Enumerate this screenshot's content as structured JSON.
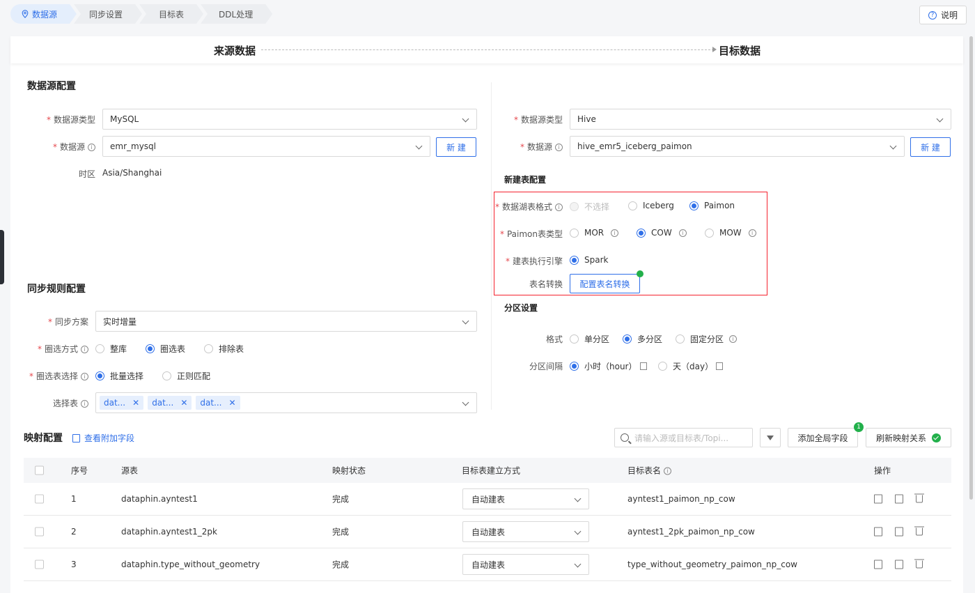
{
  "steps": [
    "数据源",
    "同步设置",
    "目标表",
    "DDL处理"
  ],
  "help_label": "说明",
  "header": {
    "left": "来源数据",
    "right": "目标数据"
  },
  "source": {
    "section_title": "数据源配置",
    "type_label": "数据源类型",
    "type_value": "MySQL",
    "ds_label": "数据源",
    "ds_value": "emr_mysql",
    "new_btn": "新 建",
    "tz_label": "时区",
    "tz_value": "Asia/Shanghai"
  },
  "target": {
    "type_label": "数据源类型",
    "type_value": "Hive",
    "ds_label": "数据源",
    "ds_value": "hive_emr5_iceberg_paimon",
    "new_btn": "新 建",
    "newtable_title": "新建表配置",
    "lake_label": "数据湖表格式",
    "lake_options": [
      "不选择",
      "Iceberg",
      "Paimon"
    ],
    "paimon_label": "Paimon表类型",
    "paimon_options": [
      "MOR",
      "COW",
      "MOW"
    ],
    "engine_label": "建表执行引擎",
    "engine_value": "Spark",
    "rename_label": "表名转换",
    "rename_btn": "配置表名转换",
    "partition_title": "分区设置",
    "format_label": "格式",
    "format_options": [
      "单分区",
      "多分区",
      "固定分区"
    ],
    "interval_label": "分区间隔",
    "interval_options": [
      "小时（hour）",
      "天（day）"
    ]
  },
  "rules": {
    "section_title": "同步规则配置",
    "plan_label": "同步方案",
    "plan_value": "实时增量",
    "mode_label": "圈选方式",
    "mode_options": [
      "整库",
      "圈选表",
      "排除表"
    ],
    "select_label": "圈选表选择",
    "select_options": [
      "批量选择",
      "正则匹配"
    ],
    "tables_label": "选择表",
    "tags": [
      "dat...",
      "dat...",
      "dat..."
    ]
  },
  "mapping": {
    "title": "映射配置",
    "extra_link": "查看附加字段",
    "search_placeholder": "请输入源或目标表/Topi...",
    "add_global": "添加全局字段",
    "badge": "1",
    "refresh": "刷新映射关系",
    "columns": [
      "序号",
      "源表",
      "映射状态",
      "目标表建立方式",
      "目标表名",
      "操作"
    ],
    "rows": [
      {
        "no": "1",
        "src": "dataphin.ayntest1",
        "status": "完成",
        "method": "自动建表",
        "target": "ayntest1_paimon_np_cow"
      },
      {
        "no": "2",
        "src": "dataphin.ayntest1_2pk",
        "status": "完成",
        "method": "自动建表",
        "target": "ayntest1_2pk_paimon_np_cow"
      },
      {
        "no": "3",
        "src": "dataphin.type_without_geometry",
        "status": "完成",
        "method": "自动建表",
        "target": "type_without_geometry_paimon_np_cow"
      }
    ]
  },
  "colors": {
    "accent": "#2f6fe8",
    "required": "#e5484d",
    "success": "#22b04b",
    "highlight_border": "#f5222d"
  }
}
